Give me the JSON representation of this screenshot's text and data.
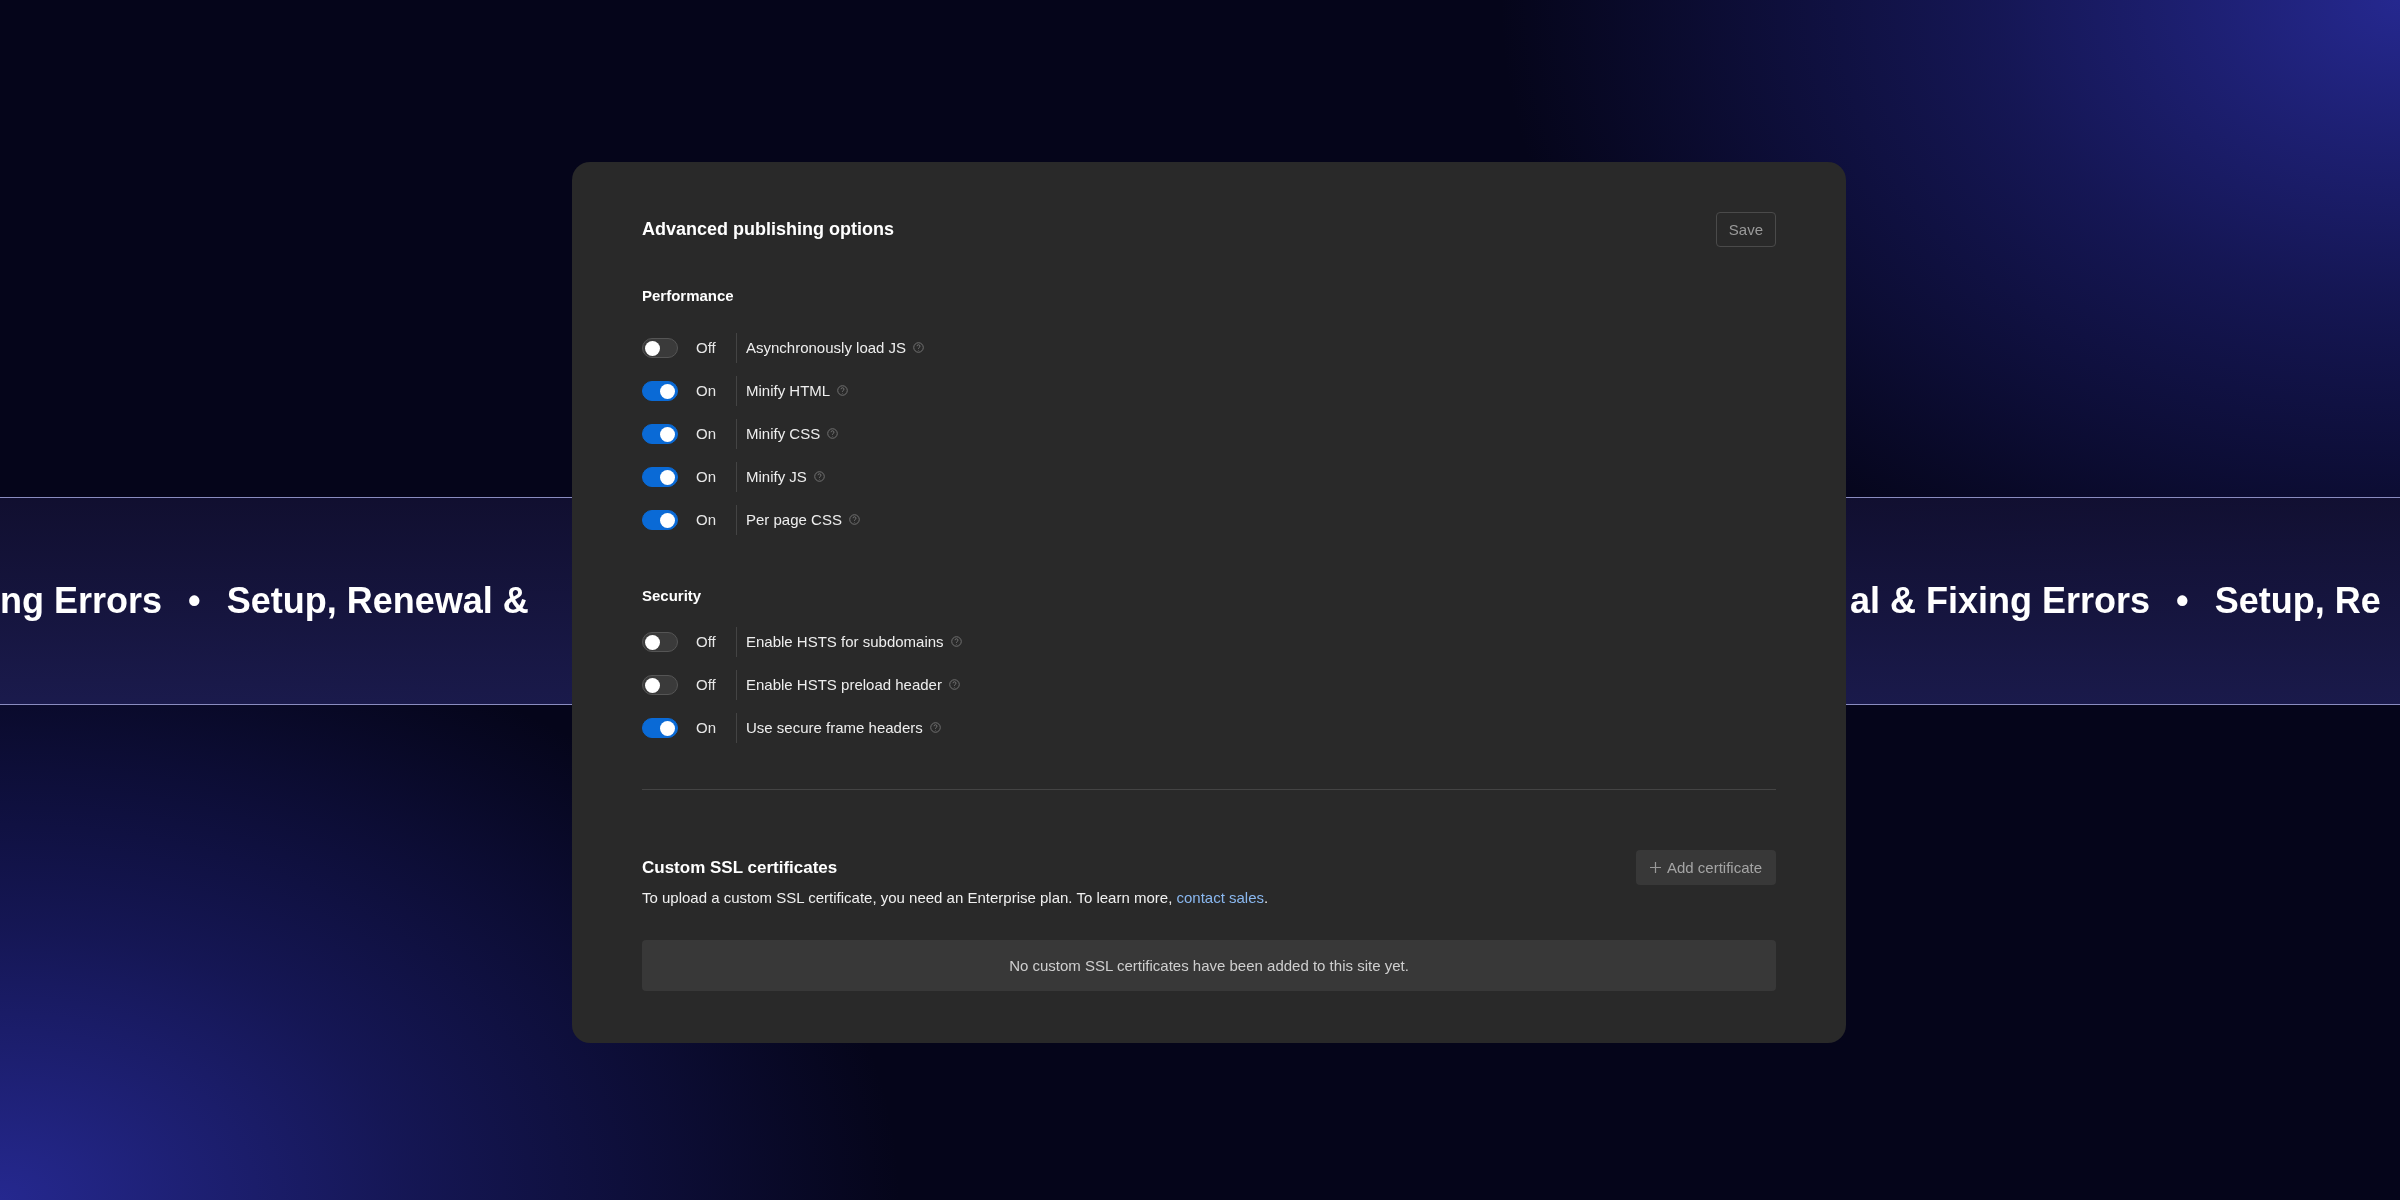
{
  "banner": {
    "left": [
      "ng Errors",
      "•",
      "Setup, Renewal &"
    ],
    "right": [
      "al & Fixing Errors",
      "•",
      "Setup, Re"
    ]
  },
  "dialog": {
    "title": "Advanced publishing options",
    "save_button": "Save",
    "sections": [
      {
        "heading": "Performance",
        "options": [
          {
            "label": "Asynchronously load JS",
            "on": false,
            "state": "Off"
          },
          {
            "label": "Minify HTML",
            "on": true,
            "state": "On"
          },
          {
            "label": "Minify CSS",
            "on": true,
            "state": "On"
          },
          {
            "label": "Minify JS",
            "on": true,
            "state": "On"
          },
          {
            "label": "Per page CSS",
            "on": true,
            "state": "On"
          }
        ]
      },
      {
        "heading": "Security",
        "options": [
          {
            "label": "Enable HSTS for subdomains",
            "on": false,
            "state": "Off"
          },
          {
            "label": "Enable HSTS preload header",
            "on": false,
            "state": "Off"
          },
          {
            "label": "Use secure frame headers",
            "on": true,
            "state": "On"
          }
        ]
      }
    ],
    "ssl": {
      "heading": "Custom SSL certificates",
      "add_button": "Add certificate",
      "description": "To upload a custom SSL certificate, you need an Enterprise plan. To learn more, ",
      "link": "contact sales",
      "after_link": ".",
      "empty_message": "No custom SSL certificates have been added to this site yet."
    }
  }
}
